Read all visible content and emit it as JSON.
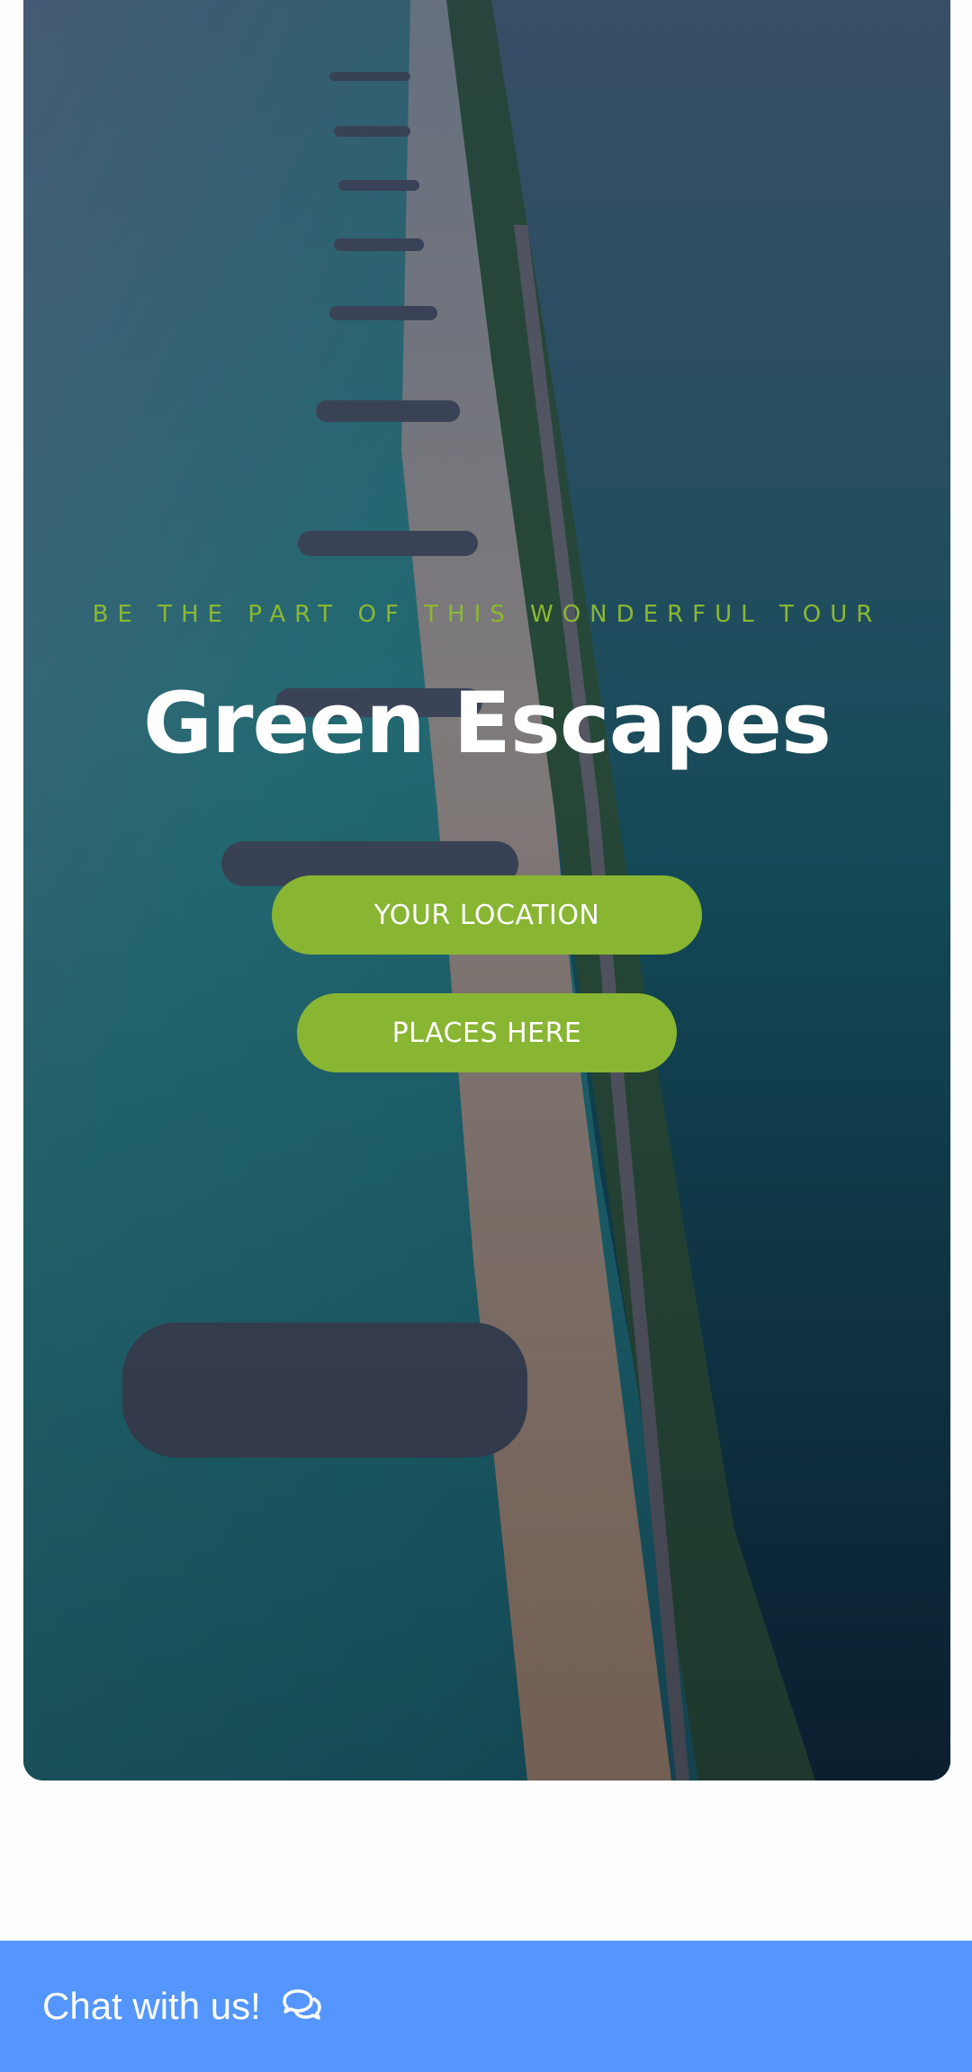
{
  "hero": {
    "tagline": "BE THE PART OF THIS WONDERFUL TOUR",
    "title": "Green Escapes",
    "background_image": "aerial-coastline-photo",
    "buttons": {
      "location_label": "YOUR LOCATION",
      "places_label": "PLACES HERE"
    }
  },
  "chat": {
    "label": "Chat with us!",
    "icon": "chat-bubbles-icon"
  },
  "colors": {
    "accent_green": "#88b532",
    "chat_blue": "#5496fd",
    "text_white": "#ffffff"
  }
}
